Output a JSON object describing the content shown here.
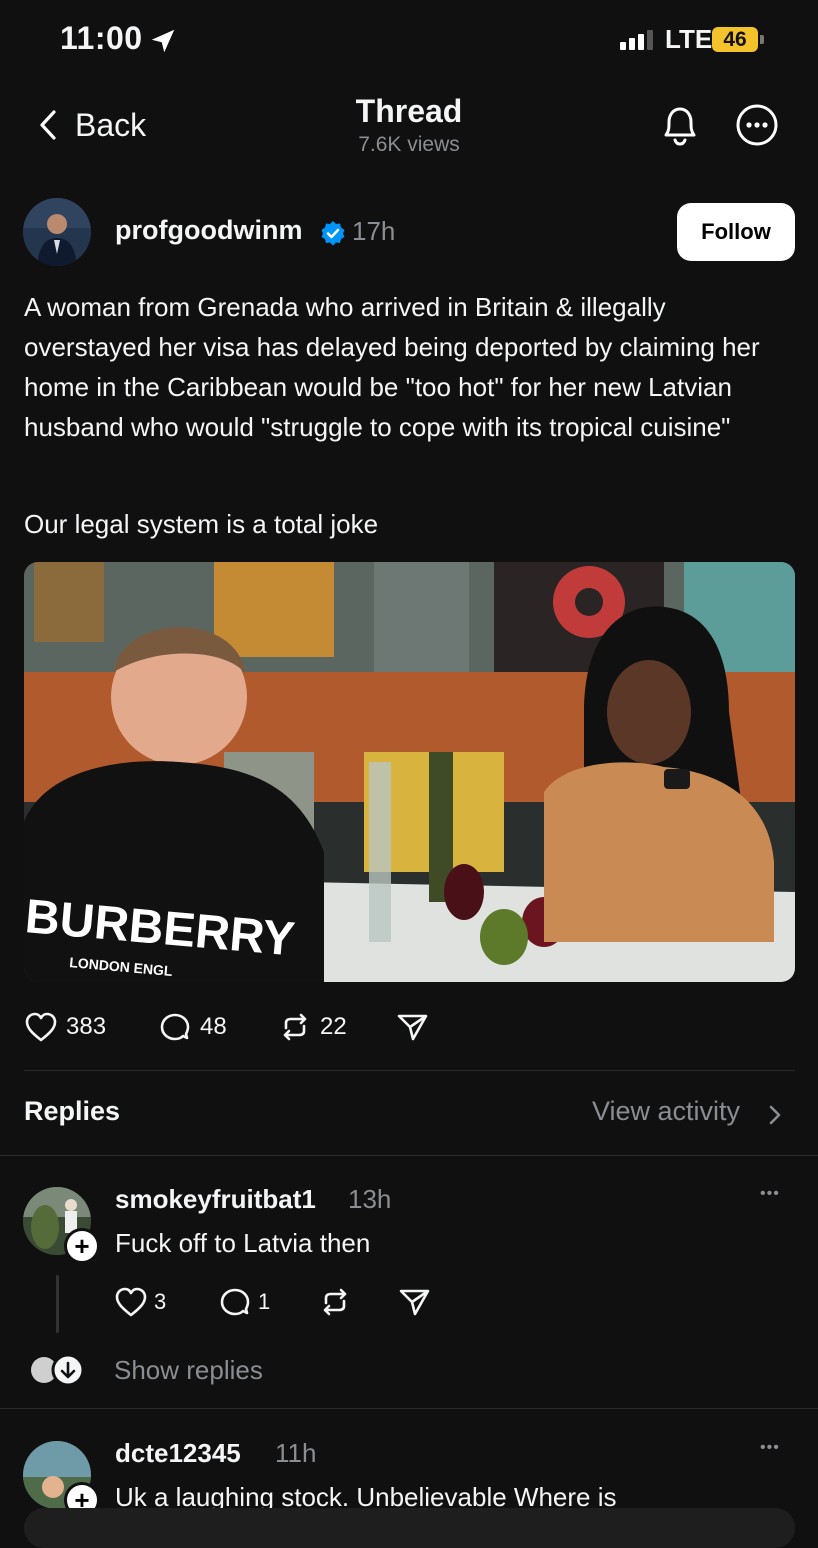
{
  "status_bar": {
    "time": "11:00",
    "network": "LTE",
    "battery": "46"
  },
  "header": {
    "back_label": "Back",
    "title": "Thread",
    "views": "7.6K views"
  },
  "post": {
    "author": "profgoodwinm",
    "time": "17h",
    "follow_label": "Follow",
    "text": "A woman from Grenada who arrived in Britain & illegally overstayed her visa has delayed being deported by claiming her home in the Caribbean would be \"too hot\" for her new Latvian husband who would \"struggle to cope with its tropical cuisine\"",
    "text2": "Our legal system is a total joke",
    "photo_shirt_text": "BURBERRY",
    "photo_shirt_subtext": "LONDON ENGL",
    "likes": "383",
    "comments": "48",
    "reposts": "22"
  },
  "replies_section": {
    "label": "Replies",
    "view_activity": "View activity"
  },
  "replies": [
    {
      "author": "smokeyfruitbat1",
      "time": "13h",
      "text": "Fuck off to Latvia then",
      "likes": "3",
      "comments": "1"
    },
    {
      "author": "dcte12345",
      "time": "11h",
      "text": "Uk a laughing stock. Unbelievable  Where is"
    }
  ],
  "show_replies_label": "Show replies",
  "more_glyph": "•••",
  "colors": {
    "background": "#101010",
    "verified": "#0095f6",
    "muted": "#8a8d91",
    "battery": "#f4c32c"
  }
}
